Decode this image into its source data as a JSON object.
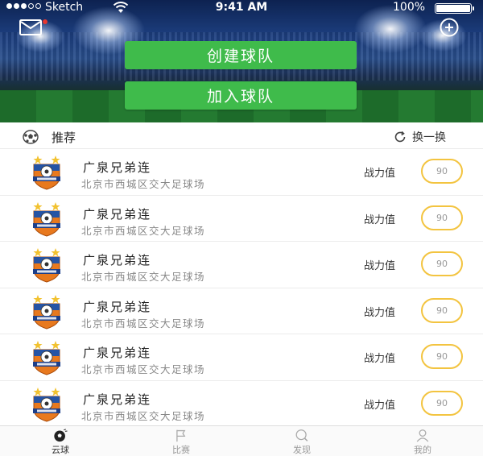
{
  "status_bar": {
    "carrier": "Sketch",
    "time": "9:41 AM",
    "battery": "100%"
  },
  "hero": {
    "create_team_label": "创建球队",
    "join_team_label": "加入球队",
    "mail_icon": "mail-icon",
    "add_icon": "plus-circle-icon",
    "unread_dot_color": "#e8372f"
  },
  "recommend": {
    "title": "推荐",
    "refresh_label": "换一换",
    "icon": "soccer-ball-icon"
  },
  "teams": [
    {
      "name": "广泉兄弟连",
      "address": "北京市西城区交大足球场",
      "power_label": "战力值",
      "power": "90"
    },
    {
      "name": "广泉兄弟连",
      "address": "北京市西城区交大足球场",
      "power_label": "战力值",
      "power": "90"
    },
    {
      "name": "广泉兄弟连",
      "address": "北京市西城区交大足球场",
      "power_label": "战力值",
      "power": "90"
    },
    {
      "name": "广泉兄弟连",
      "address": "北京市西城区交大足球场",
      "power_label": "战力值",
      "power": "90"
    },
    {
      "name": "广泉兄弟连",
      "address": "北京市西城区交大足球场",
      "power_label": "战力值",
      "power": "90"
    },
    {
      "name": "广泉兄弟连",
      "address": "北京市西城区交大足球场",
      "power_label": "战力值",
      "power": "90"
    }
  ],
  "tabs": [
    {
      "label": "云球",
      "icon": "soccer-ball-icon",
      "active": true
    },
    {
      "label": "比赛",
      "icon": "flag-icon",
      "active": false
    },
    {
      "label": "发现",
      "icon": "search-icon",
      "active": false
    },
    {
      "label": "我的",
      "icon": "user-icon",
      "active": false
    }
  ],
  "colors": {
    "accent_green": "#3fbb4b",
    "power_ring": "#f3c440"
  }
}
